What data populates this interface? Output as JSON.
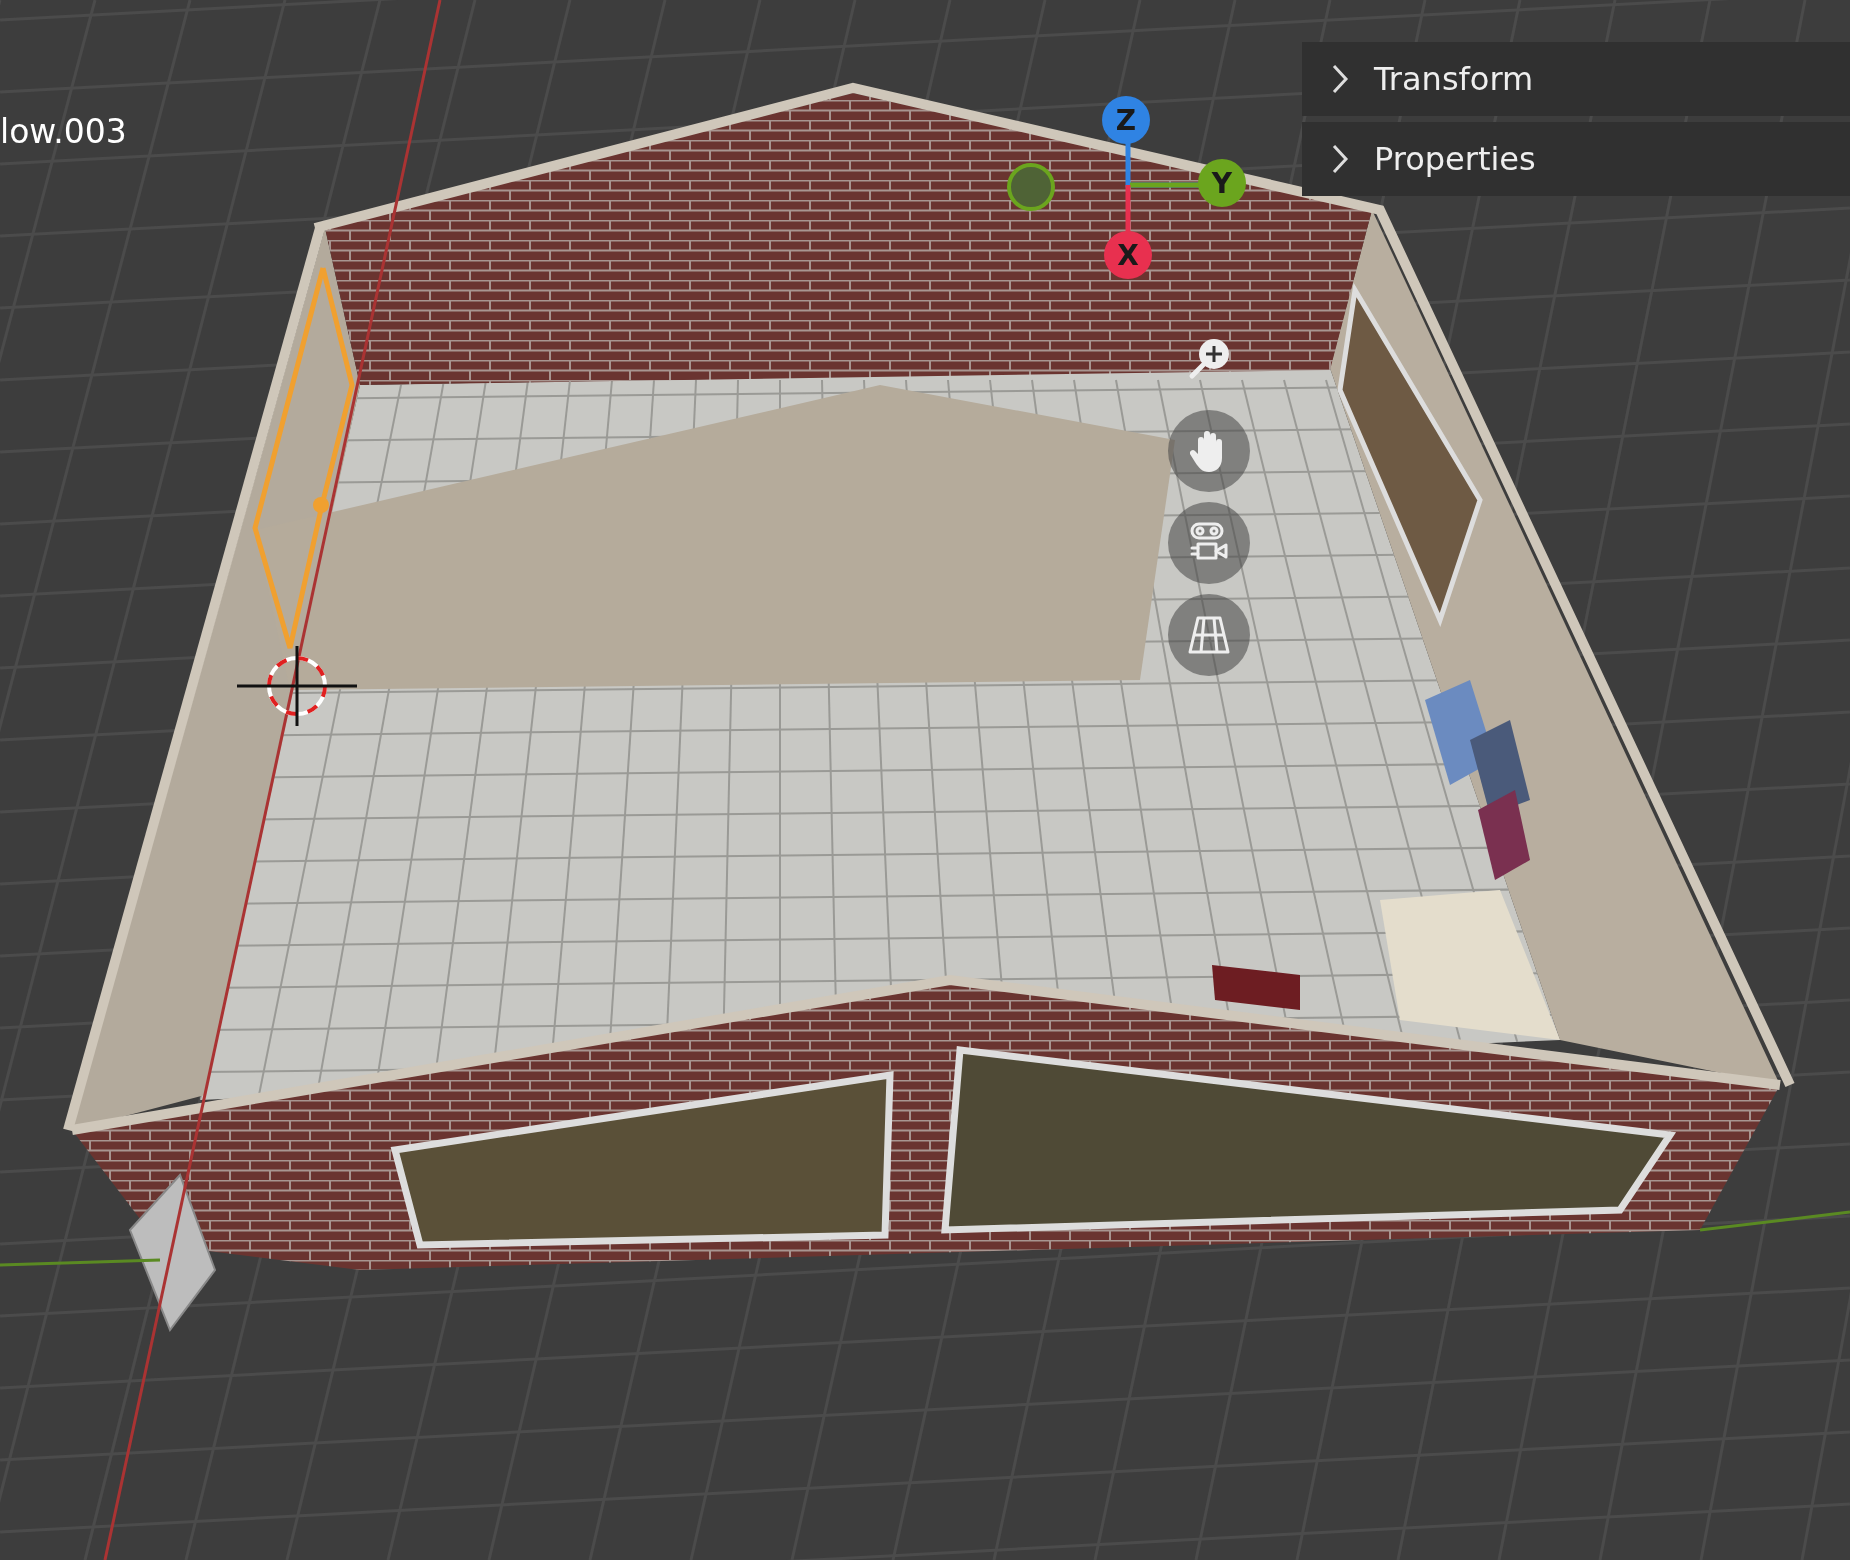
{
  "viewport": {
    "object_name": "low.003"
  },
  "navigation_gizmo": {
    "axes": [
      {
        "label": "Z",
        "color": "#2f83e3"
      },
      {
        "label": "Y",
        "color": "#6ba51e"
      },
      {
        "label": "X",
        "color": "#e8304f"
      }
    ]
  },
  "navigation_tools": [
    {
      "kind": "zoom"
    },
    {
      "kind": "pan"
    },
    {
      "kind": "camera"
    },
    {
      "kind": "ortho"
    }
  ],
  "sidebar": {
    "panels": [
      {
        "label": "Transform",
        "expanded": false
      },
      {
        "label": "Properties",
        "expanded": false
      }
    ]
  }
}
